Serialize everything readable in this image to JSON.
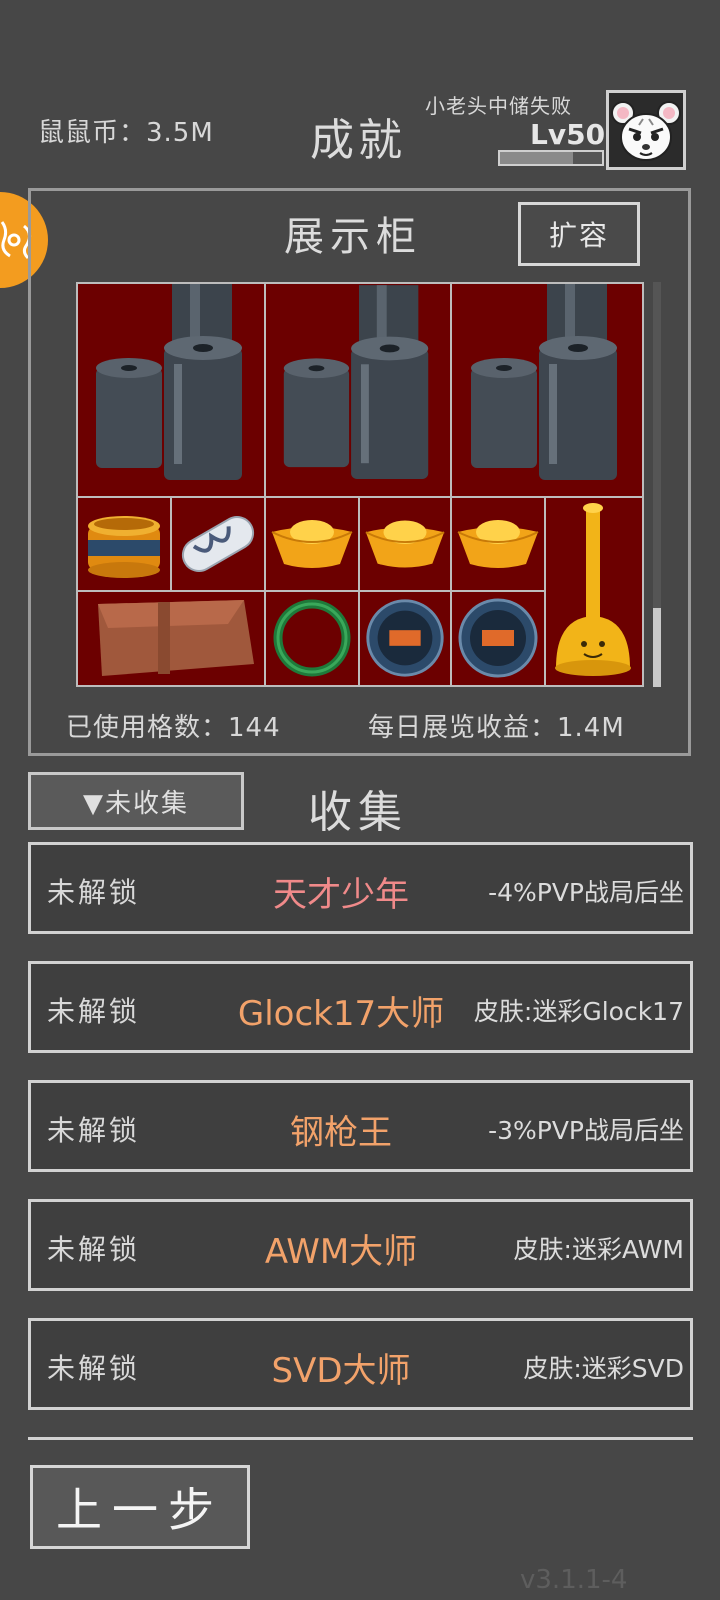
{
  "header": {
    "coins_label": "鼠鼠币：3.5M",
    "title": "成就",
    "player_name": "小老头中储失败",
    "level": "Lv50",
    "level_progress": 0.72
  },
  "cabinet": {
    "title": "展示柜",
    "expand_button": "扩容",
    "used_cells_label": "已使用格数：144",
    "daily_income_label": "每日展览收益：1.4M",
    "items": [
      "toilet-paper-rolls-icon",
      "toilet-paper-rolls-icon",
      "toilet-paper-rolls-icon",
      "golden-jar-icon",
      "vial-icon",
      "gold-ingot-icon",
      "gold-ingot-icon",
      "gold-ingot-icon",
      "golden-plunger-icon",
      "leather-folder-icon",
      "jade-bracelet-icon",
      "diving-watch-icon",
      "diving-watch-icon"
    ]
  },
  "collect": {
    "filter_button": "▼未收集",
    "title": "收集"
  },
  "achievements": [
    {
      "status": "未解锁",
      "name": "天才少年",
      "reward": "-4%PVP战局后坐",
      "color": "#f08a8a"
    },
    {
      "status": "未解锁",
      "name": "Glock17大师",
      "reward": "皮肤:迷彩Glock17",
      "color": "#f2a26a"
    },
    {
      "status": "未解锁",
      "name": "钢枪王",
      "reward": "-3%PVP战局后坐",
      "color": "#f2a26a"
    },
    {
      "status": "未解锁",
      "name": "AWM大师",
      "reward": "皮肤:迷彩AWM",
      "color": "#f2a26a"
    },
    {
      "status": "未解锁",
      "name": "SVD大师",
      "reward": "皮肤:迷彩SVD",
      "color": "#f2a26a"
    }
  ],
  "back_button": "上一步",
  "version": "v3.1.1-4",
  "colors": {
    "background": "#474747",
    "cabinet_bg": "#6c0000",
    "side_badge": "#f39c1f"
  }
}
